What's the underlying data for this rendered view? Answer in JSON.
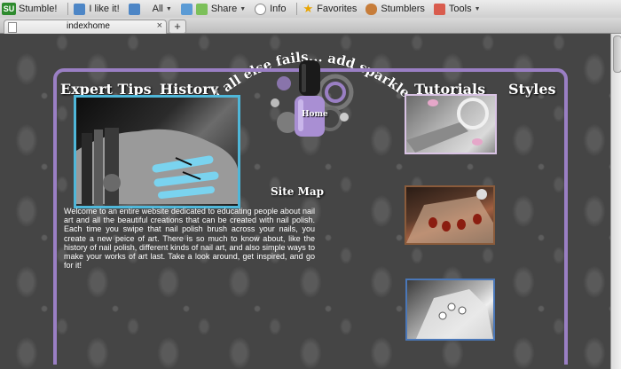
{
  "toolbar": {
    "logo": "SU",
    "stumble": "Stumble!",
    "like": "I like it!",
    "topic": "All",
    "share": "Share",
    "info": "Info",
    "favorites": "Favorites",
    "stumblers": "Stumblers",
    "tools": "Tools"
  },
  "tabs": [
    {
      "label": "indexhome"
    }
  ],
  "site": {
    "tagline": "If all else fails... add sparkles",
    "nav": {
      "expert_tips": "Expert Tips",
      "history": "History",
      "tutorials": "Tutorials",
      "styles": "Styles"
    },
    "home_label": "Home",
    "sitemap": "Site Map",
    "intro": "Welcome to an entire website dedicated to educating people about nail art and all the beautiful creations that can be created with nail polish. Each time you swipe that nail polish brush across your nails, you create a new peice of art. There is so much to know about, like the history of nail polish, different kinds of nail art, and also simple ways to make your works of art last. Take a look around, get inspired, and go for it!"
  },
  "colors": {
    "frame": "#9a7fc4",
    "polish": "#a98fd3",
    "main_photo_border": "#4fb7d9",
    "thumb1_border": "#d9c3e4",
    "thumb2_border": "#8a5b3b",
    "thumb3_border": "#4a77b8"
  },
  "icons": {
    "stumble": "stumbleupon-logo-icon",
    "like": "thumbs-up-icon",
    "share": "share-tag-icon",
    "info": "speech-bubble-icon",
    "favorites": "star-icon",
    "stumblers": "people-icon",
    "tools": "toolbox-icon"
  }
}
